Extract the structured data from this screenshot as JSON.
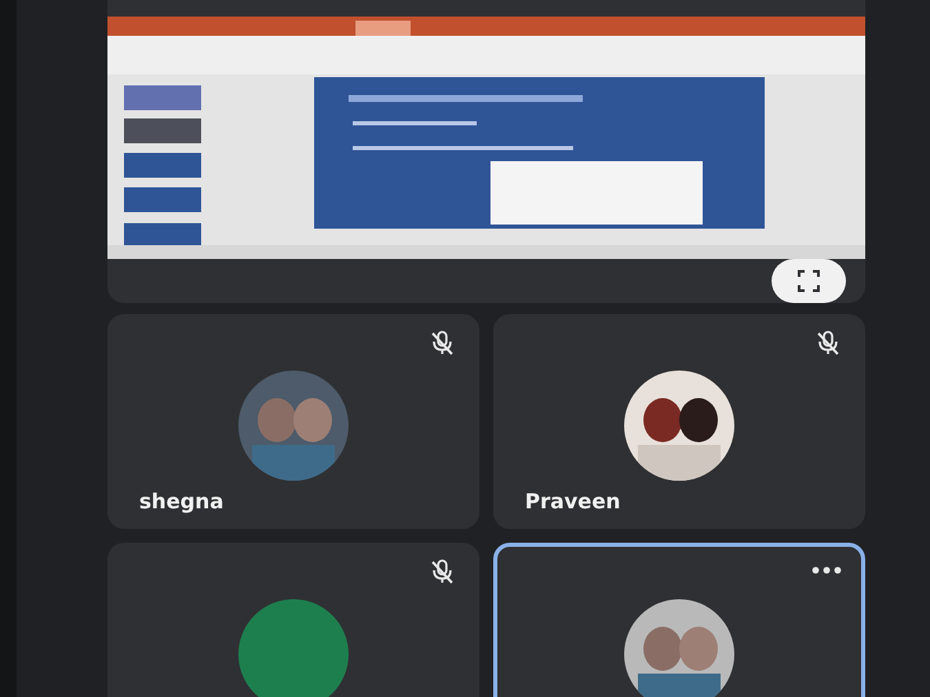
{
  "tiles": [
    {
      "name": "shegna",
      "muted": true,
      "selected": false
    },
    {
      "name": "Praveen",
      "muted": true,
      "selected": false
    },
    {
      "muted": true,
      "selected": false,
      "avatar": {
        "kind": "color",
        "color": "#1e7f4e"
      }
    },
    {
      "muted": false,
      "selected": true
    }
  ]
}
